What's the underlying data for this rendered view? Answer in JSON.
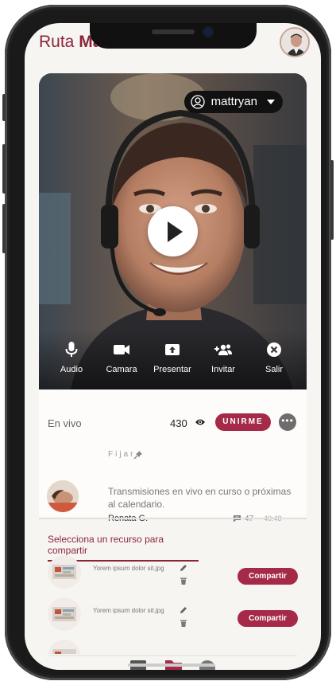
{
  "header": {
    "app_title_part1": "Ruta ",
    "app_title_part2": "Ma"
  },
  "video": {
    "user_select_value": "mattryan",
    "controls": [
      {
        "label": "Audio",
        "icon": "microphone-icon"
      },
      {
        "label": "Camara",
        "icon": "video-camera-icon"
      },
      {
        "label": "Presentar",
        "icon": "present-screen-icon"
      },
      {
        "label": "Invitar",
        "icon": "invite-users-icon"
      },
      {
        "label": "Salir",
        "icon": "close-circle-icon"
      }
    ]
  },
  "live": {
    "status_label": "En vivo",
    "viewer_count": "430",
    "join_label": "UNIRME",
    "more_label": "•••"
  },
  "pinned": {
    "pin_label": "Fijar",
    "message": "Transmisiones en vivo en curso o próximas al calendario.",
    "author": "Renata G.",
    "comment_count": "47",
    "time": "40:48"
  },
  "share": {
    "title": "Selecciona un recurso para compartir",
    "resources": [
      {
        "name": "Yorem ipsum dolor sit.jpg",
        "button": "Compartir"
      },
      {
        "name": "Yorem ipsum dolor sit.jpg",
        "button": "Compartir"
      }
    ]
  },
  "colors": {
    "accent": "#a42a48",
    "title": "#8c2438",
    "background": "#f7f5f2"
  }
}
